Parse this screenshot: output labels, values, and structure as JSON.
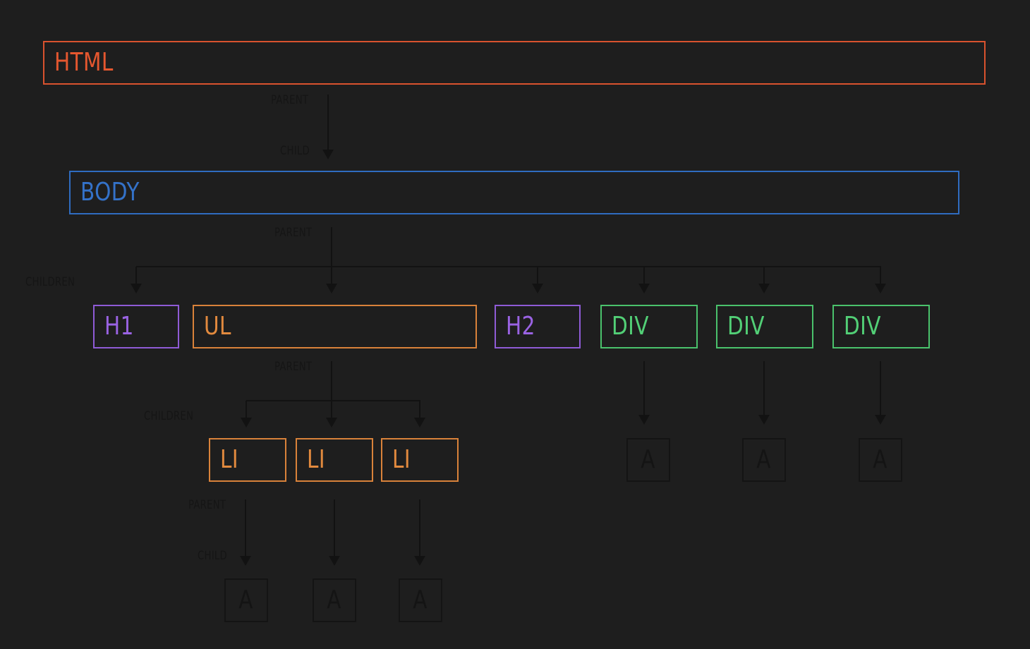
{
  "nodes": {
    "html": "HTML",
    "body": "BODY",
    "h1": "H1",
    "ul": "UL",
    "h2": "H2",
    "div": "DIV",
    "li": "LI",
    "a": "A"
  },
  "captions": {
    "parent": "PARENT",
    "child": "CHILD",
    "children": "CHILDREN"
  },
  "colors": {
    "background": "#1e1e1e",
    "html": "#e5572f",
    "body": "#3472c9",
    "heading": "#9a63e3",
    "list": "#e28a3e",
    "div": "#52cf76",
    "muted": "#141414"
  }
}
